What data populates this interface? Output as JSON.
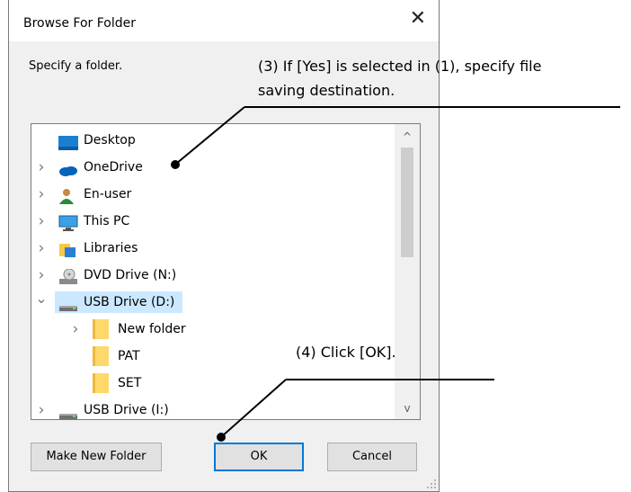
{
  "dialog": {
    "title": "Browse For Folder",
    "close_glyph": "✕",
    "prompt": "Specify a folder."
  },
  "tree": {
    "items": [
      {
        "label": "Desktop",
        "icon": "desktop-icon",
        "expander": "",
        "indent": 0
      },
      {
        "label": "OneDrive",
        "icon": "onedrive-icon",
        "expander": "collapsed",
        "indent": 0
      },
      {
        "label": "En-user",
        "icon": "user-icon",
        "expander": "collapsed",
        "indent": 0
      },
      {
        "label": "This PC",
        "icon": "this-pc-icon",
        "expander": "collapsed",
        "indent": 0
      },
      {
        "label": "Libraries",
        "icon": "libraries-icon",
        "expander": "collapsed",
        "indent": 0
      },
      {
        "label": "DVD Drive (N:)",
        "icon": "dvd-drive-icon",
        "expander": "collapsed",
        "indent": 0
      },
      {
        "label": "USB Drive (D:)",
        "icon": "usb-drive-icon",
        "expander": "expanded",
        "indent": 0,
        "selected": true
      },
      {
        "label": "New folder",
        "icon": "folder-icon",
        "expander": "collapsed",
        "indent": 1
      },
      {
        "label": "PAT",
        "icon": "folder-icon",
        "expander": "",
        "indent": 1
      },
      {
        "label": "SET",
        "icon": "folder-icon",
        "expander": "",
        "indent": 1
      },
      {
        "label": "USB Drive (I:)",
        "icon": "usb-drive-icon",
        "expander": "collapsed",
        "indent": 0
      }
    ],
    "scroll_up_glyph": "^",
    "scroll_down_glyph": "v"
  },
  "buttons": {
    "make_new_folder": "Make New Folder",
    "ok": "OK",
    "cancel": "Cancel"
  },
  "annotations": {
    "step3_line1": "(3) If [Yes] is selected in (1), specify file",
    "step3_line2": "saving destination.",
    "step4": "(4) Click [OK]."
  },
  "colors": {
    "selection": "#cce8ff",
    "default_button_border": "#0078d7",
    "onedrive": "#0364b8",
    "folder": "#ffd86b"
  }
}
